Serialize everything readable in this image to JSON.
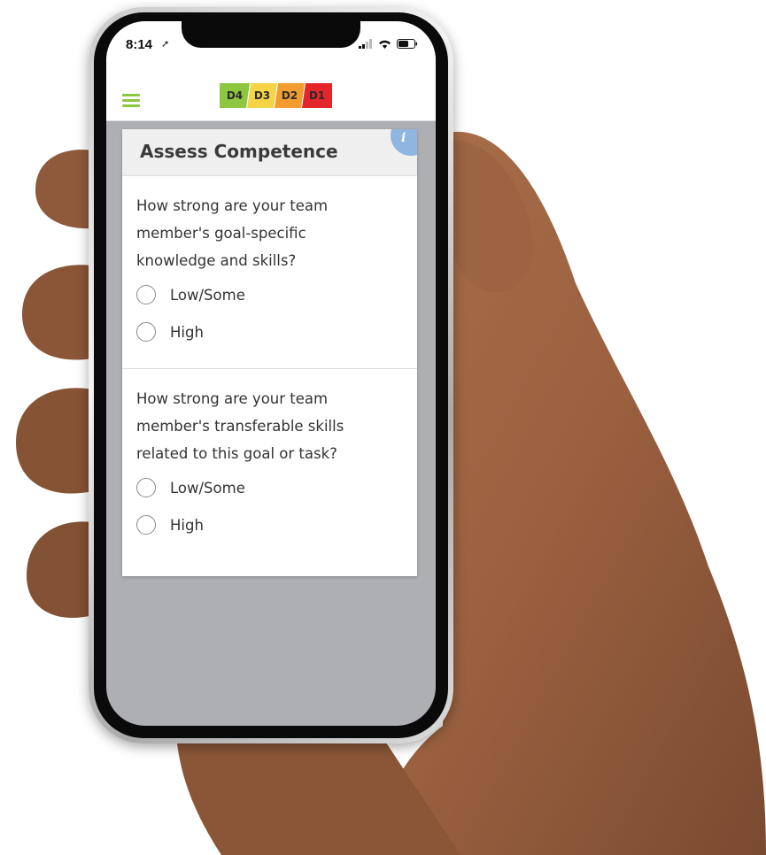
{
  "status_bar": {
    "time": "8:14"
  },
  "header": {
    "menu_icon": "hamburger-menu-icon",
    "badges": [
      {
        "label": "D4",
        "color": "#8dc63f"
      },
      {
        "label": "D3",
        "color": "#f5d547"
      },
      {
        "label": "D2",
        "color": "#f39c2f"
      },
      {
        "label": "D1",
        "color": "#e4262a"
      }
    ]
  },
  "card": {
    "title": "Assess Competence",
    "info_icon": "info-icon",
    "info_label": "i",
    "questions": [
      {
        "text": "How strong are your team member's goal-specific knowledge and skills?",
        "options": [
          {
            "label": "Low/Some"
          },
          {
            "label": "High"
          }
        ]
      },
      {
        "text": "How strong are your team member's transferable skills related to this goal or task?",
        "options": [
          {
            "label": "Low/Some"
          },
          {
            "label": "High"
          }
        ]
      }
    ]
  },
  "colors": {
    "accent_green": "#8dc63f",
    "info_blue": "#8fb5e1",
    "screen_gray": "#adafb3"
  }
}
